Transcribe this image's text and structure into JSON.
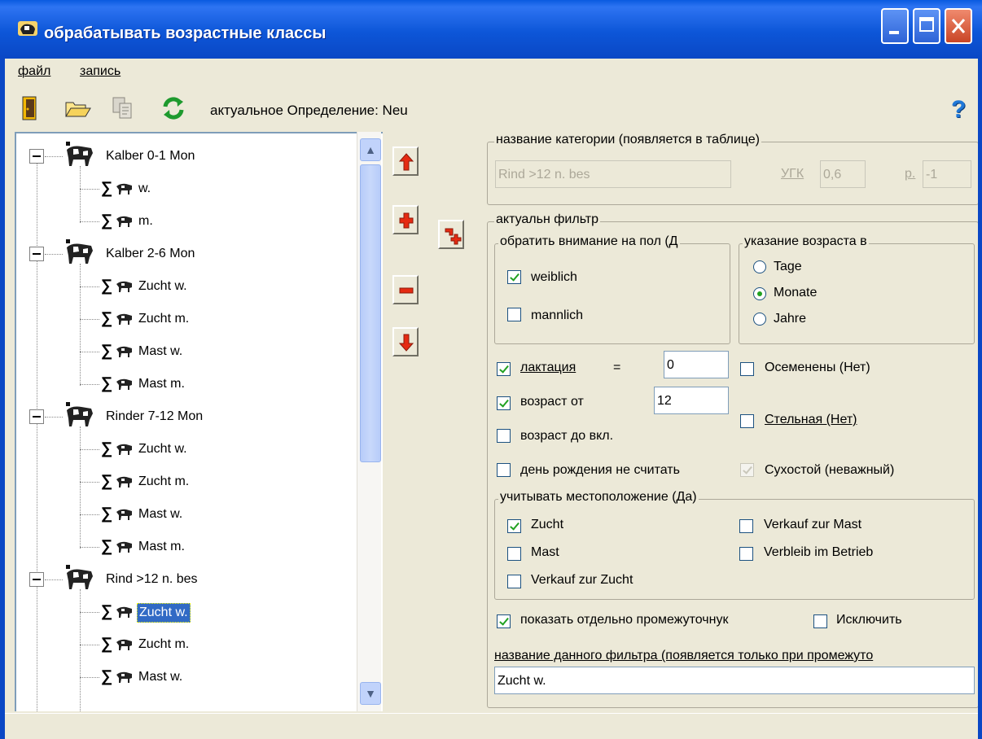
{
  "window": {
    "title": "обрабатывать возрастные классы",
    "accent": "#0A47C5",
    "controls": [
      "minimize-icon",
      "maximize-icon",
      "close-icon"
    ]
  },
  "menu": {
    "items": [
      {
        "label": "файл"
      },
      {
        "label": "запись"
      }
    ]
  },
  "toolbar": {
    "icons": [
      "exit-door-icon",
      "open-folder-icon",
      "copy-document-icon",
      "refresh-icon"
    ],
    "definition_label": "актуальное Определение: Neu",
    "help_icon": "?"
  },
  "tree": {
    "groups": [
      {
        "label": "Kalber 0-1 Mon",
        "children": [
          "w.",
          "m."
        ]
      },
      {
        "label": "Kalber 2-6 Mon",
        "children": [
          "Zucht w.",
          "Zucht m.",
          "Mast w.",
          "Mast m."
        ]
      },
      {
        "label": "Rinder 7-12 Mon",
        "children": [
          "Zucht w.",
          "Zucht m.",
          "Mast w.",
          "Mast m."
        ]
      },
      {
        "label": "Rind >12 n. bes",
        "children": [
          "Zucht w.",
          "Zucht m.",
          "Mast w."
        ]
      }
    ],
    "selected": "Rind >12 n. bes / Zucht w."
  },
  "side_buttons": [
    "move-up-icon",
    "add-icon",
    "remove-icon",
    "move-down-icon",
    "add-subitem-icon"
  ],
  "category": {
    "legend": "название категории (появляется в таблице)",
    "name_value": "Rind >12 n. bes",
    "ugk_label": "УГК",
    "ugk_value": "0,6",
    "p_label": "p.",
    "p_value": "-1"
  },
  "filter": {
    "legend": "актуальн фильтр",
    "sex": {
      "legend": "обратить внимание на пол (Д",
      "female_label": "weiblich",
      "female_checked": true,
      "male_label": "mannlich",
      "male_checked": false
    },
    "age_unit": {
      "legend": "указание возраста в",
      "options": [
        "Tage",
        "Monate",
        "Jahre"
      ],
      "selected": "Monate"
    },
    "lactation_label": "лактация",
    "lactation_op": "=",
    "lactation_value": "0",
    "lactation_checked": true,
    "age_from_label": "возраст от",
    "age_from_value": "12",
    "age_from_checked": true,
    "age_to_label": "возраст до вкл.",
    "age_to_checked": false,
    "birthday_label": "день рождения не считать",
    "birthday_checked": false,
    "inseminated_label": "Осеменены (Нет)",
    "inseminated_checked": false,
    "pregnant_label": "Стельная (Нет)",
    "pregnant_checked": false,
    "dry_label": "Сухостой (неважный)",
    "dry_checked": true,
    "location": {
      "legend": "учитывать местоположение (Да)",
      "items": [
        {
          "label": "Zucht",
          "checked": true
        },
        {
          "label": "Mast",
          "checked": false
        },
        {
          "label": "Verkauf zur Zucht",
          "checked": false
        },
        {
          "label": "Verkauf zur Mast",
          "checked": false
        },
        {
          "label": "Verbleib im Betrieb",
          "checked": false
        }
      ]
    },
    "show_separately_label": "показать отдельно промежуточнук",
    "show_separately_checked": true,
    "exclude_label": "Исключить",
    "exclude_checked": false,
    "filter_name_label": "название данного фильтра (появляется только при промежуто",
    "filter_name_value": "Zucht w."
  }
}
